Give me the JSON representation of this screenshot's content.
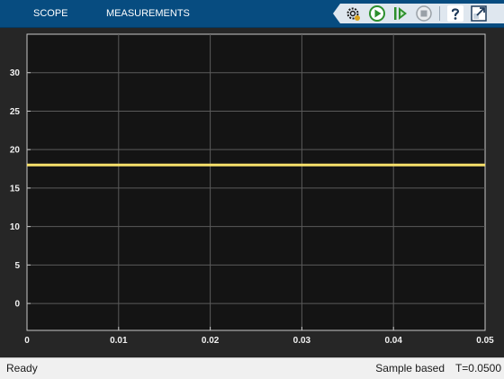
{
  "toolbar": {
    "tabs": [
      {
        "label": "SCOPE"
      },
      {
        "label": "MEASUREMENTS"
      }
    ],
    "buttons": [
      {
        "icon": "settings-icon"
      },
      {
        "icon": "run-icon"
      },
      {
        "icon": "step-forward-icon"
      },
      {
        "icon": "stop-icon"
      },
      {
        "icon": "help-icon"
      },
      {
        "icon": "undock-icon"
      }
    ]
  },
  "status": {
    "text": "Ready",
    "mode": "Sample based",
    "time": "T=0.0500"
  },
  "colors": {
    "toolbar_bg": "#074c80",
    "plot_bg": "#141414",
    "grid": "#5a5a5a",
    "signal": "#f7e06b"
  },
  "chart_data": {
    "type": "line",
    "xlim": [
      0,
      0.05
    ],
    "ylim": [
      -3.5,
      35
    ],
    "xticks": [
      0,
      0.01,
      0.02,
      0.03,
      0.04,
      0.05
    ],
    "xtick_labels": [
      "0",
      "0.01",
      "0.02",
      "0.03",
      "0.04",
      "0.05"
    ],
    "yticks": [
      0,
      5,
      10,
      15,
      20,
      25,
      30
    ],
    "ytick_labels": [
      "0",
      "5",
      "10",
      "15",
      "20",
      "25",
      "30"
    ],
    "grid": true,
    "series": [
      {
        "x": [
          0,
          0.01,
          0.02,
          0.03,
          0.04,
          0.05
        ],
        "y": [
          18,
          18,
          18,
          18,
          18,
          18
        ]
      }
    ]
  }
}
